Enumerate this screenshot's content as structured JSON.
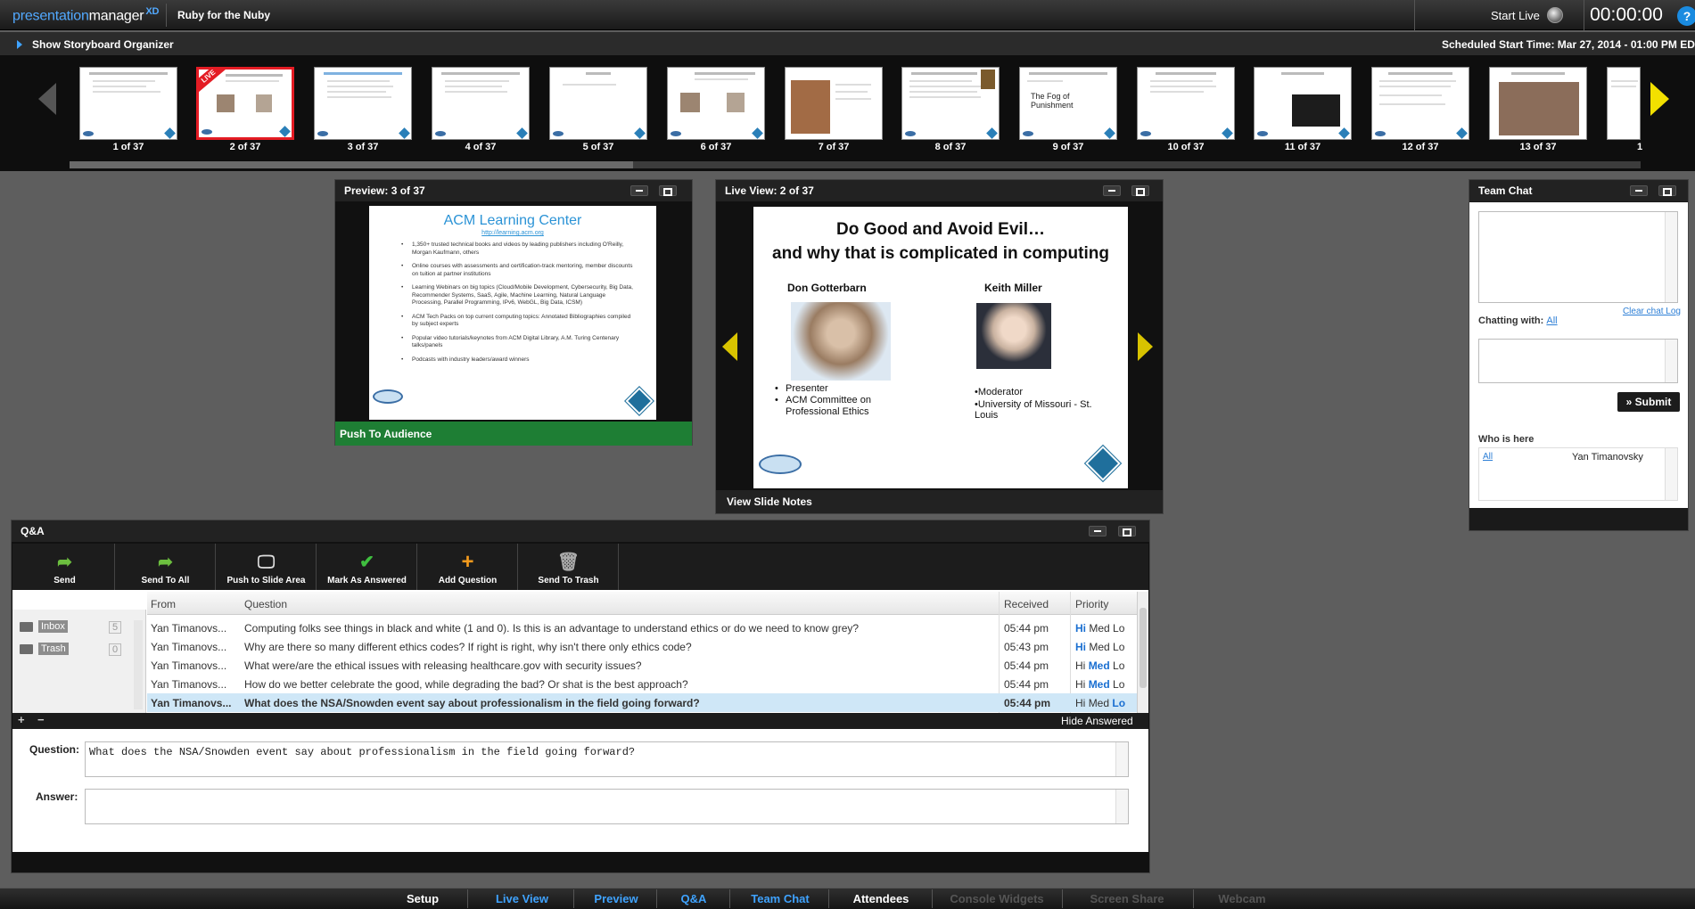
{
  "app": {
    "logo_part1": "presentation",
    "logo_part2": "manager",
    "logo_sup": "XD",
    "presentation_title": "Ruby for the Nuby",
    "start_live_label": "Start Live",
    "timer": "00:00:00",
    "help_glyph": "?"
  },
  "storyboard": {
    "toggle_label": "Show Storyboard Organizer",
    "scheduled": "Scheduled Start Time: Mar 27, 2014 - 01:00 PM EDT",
    "live_badge": "LIVE",
    "thumbnails": [
      {
        "label": "1 of 37"
      },
      {
        "label": "2 of 37",
        "live": true
      },
      {
        "label": "3 of 37"
      },
      {
        "label": "4 of 37"
      },
      {
        "label": "5 of 37"
      },
      {
        "label": "6 of 37"
      },
      {
        "label": "7 of 37"
      },
      {
        "label": "8 of 37"
      },
      {
        "label": "9 of 37",
        "text": "The Fog of Punishment"
      },
      {
        "label": "10 of 37"
      },
      {
        "label": "11 of 37"
      },
      {
        "label": "12 of 37"
      },
      {
        "label": "13 of 37"
      },
      {
        "label": "1"
      }
    ]
  },
  "preview": {
    "title": "Preview: 3 of 37",
    "slide_title": "ACM Learning Center",
    "slide_link": "http://learning.acm.org",
    "bullets": [
      "1,350+ trusted technical books and videos by leading publishers including O'Reilly, Morgan Kaufmann, others",
      "Online courses with assessments and certification-track mentoring, member discounts on tuition at partner institutions",
      "Learning Webinars on big topics (Cloud/Mobile Development, Cybersecurity, Big Data, Recommender Systems, SaaS, Agile, Machine Learning, Natural Language Processing, Parallel Programming, IPv6, WebGL, Big Data, ICSM)",
      "ACM Tech Packs on top current computing topics: Annotated Bibliographies compiled by subject experts",
      "Popular video tutorials/keynotes from ACM Digital Library, A.M. Turing Centenary talks/panels",
      "Podcasts with industry leaders/award winners"
    ],
    "push_label": "Push To Audience"
  },
  "liveview": {
    "title": "Live View: 2 of 37",
    "slide_title_1": "Do Good and Avoid Evil…",
    "slide_title_2": "and why that is complicated in computing",
    "person1_name": "Don Gotterbarn",
    "person1_bullets": [
      "Presenter",
      "ACM Committee on Professional Ethics"
    ],
    "person2_name": "Keith Miller",
    "person2_line1": "•Moderator",
    "person2_line2": "•University of Missouri - St. Louis",
    "notes_label": "View Slide Notes"
  },
  "team_chat": {
    "title": "Team Chat",
    "clear_link": "Clear chat Log",
    "chatting_with_label": "Chatting with:",
    "chatting_with_value": "All",
    "submit_label": "» Submit",
    "who_is_here_label": "Who is here",
    "who_all": "All",
    "who_user": "Yan Timanovsky"
  },
  "qa": {
    "title": "Q&A",
    "toolbar": [
      {
        "label": "Send",
        "icon": "send-icon"
      },
      {
        "label": "Send To All",
        "icon": "send-all-icon"
      },
      {
        "label": "Push to Slide Area",
        "icon": "push-slide-icon"
      },
      {
        "label": "Mark As Answered",
        "icon": "checkmark-icon"
      },
      {
        "label": "Add Question",
        "icon": "plus-icon"
      },
      {
        "label": "Send To Trash",
        "icon": "trash-icon"
      }
    ],
    "folders": [
      {
        "name": "Inbox",
        "count": "5"
      },
      {
        "name": "Trash",
        "count": "0"
      }
    ],
    "columns": {
      "from": "From",
      "question": "Question",
      "received": "Received",
      "priority": "Priority"
    },
    "rows": [
      {
        "from": "Yan Timanovs...",
        "question": "Computing folks see things in black and white (1 and 0). Is this is an advantage to understand ethics or do we need to know grey?",
        "received": "05:44 pm",
        "priority": "Hi"
      },
      {
        "from": "Yan Timanovs...",
        "question": "Why are there so many different ethics codes? If right is right, why isn't there only ethics code?",
        "received": "05:43 pm",
        "priority": "Hi"
      },
      {
        "from": "Yan Timanovs...",
        "question": "What were/are the ethical issues with releasing healthcare.gov with security issues?",
        "received": "05:44 pm",
        "priority": "Med"
      },
      {
        "from": "Yan Timanovs...",
        "question": "How do we better celebrate the good, while degrading the bad? Or shat is the best approach?",
        "received": "05:44 pm",
        "priority": "Med"
      },
      {
        "from": "Yan Timanovs...",
        "question": "What does the NSA/Snowden event say about professionalism in the field going forward?",
        "received": "05:44 pm",
        "priority": "Lo",
        "selected": true
      }
    ],
    "pri_hi": "Hi",
    "pri_med": "Med",
    "pri_lo": "Lo",
    "add_glyph": "+",
    "remove_glyph": "−",
    "hide_answered": "Hide Answered",
    "question_label": "Question:",
    "question_value": "What does the NSA/Snowden event say about professionalism in the field going forward?",
    "answer_label": "Answer:",
    "answer_value": ""
  },
  "bottom_tabs": [
    {
      "label": "Setup",
      "state": "normal"
    },
    {
      "label": "Live View",
      "state": "active"
    },
    {
      "label": "Preview",
      "state": "active"
    },
    {
      "label": "Q&A",
      "state": "active"
    },
    {
      "label": "Team Chat",
      "state": "active"
    },
    {
      "label": "Attendees",
      "state": "normal"
    },
    {
      "label": "Console Widgets",
      "state": "dim"
    },
    {
      "label": "Screen Share",
      "state": "dim"
    },
    {
      "label": "Webcam",
      "state": "dim"
    }
  ]
}
